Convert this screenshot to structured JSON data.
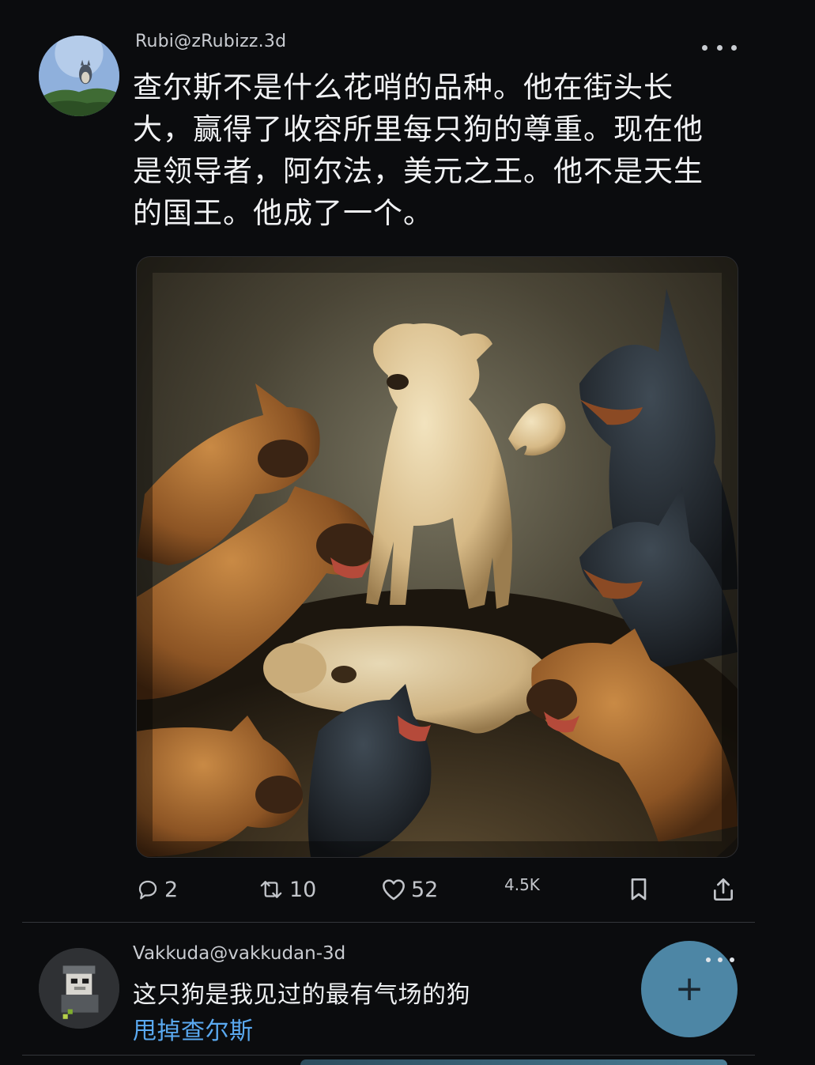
{
  "post": {
    "handle": "Rubi@zRubizz.3d",
    "text": "查尔斯不是什么花哨的品种。他在街头长\n大，赢得了收容所里每只狗的尊重。现在他\n是领导者，阿尔法，美元之王。他不是天生\n的国王。他成了一个。",
    "media_icon": "painting-of-dogs",
    "actions": {
      "replies": "2",
      "reposts": "10",
      "likes": "52",
      "views": "4.5K"
    }
  },
  "reply": {
    "handle": "Vakkuda@vakkudan-3d",
    "text": "这只狗是我见过的最有气场的狗",
    "link_text": "甩掉查尔斯"
  },
  "colors": {
    "background": "#0b0c0e",
    "text": "#f1f2f4",
    "muted": "#c2c5ca",
    "link": "#5aa9f0",
    "fab": "#4d86a5"
  }
}
